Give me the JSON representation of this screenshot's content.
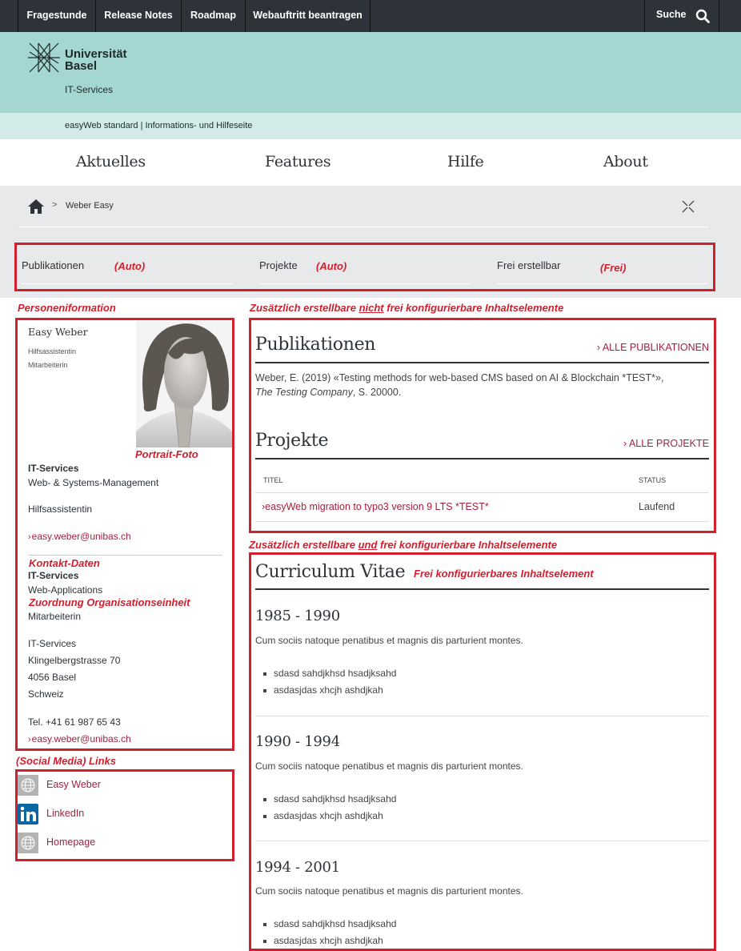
{
  "topbar": {
    "items": [
      "Fragestunde",
      "Release Notes",
      "Roadmap",
      "Webauftritt beantragen"
    ],
    "search_label": "Suche",
    "search_icon": "magnifier-icon"
  },
  "header": {
    "logo_line1": "Universität",
    "logo_line2": "Basel",
    "unit": "IT-Services",
    "subtitle": "easyWeb standard | Informations- und Hilfeseite"
  },
  "mainnav": [
    "Aktuelles",
    "Features",
    "Hilfe",
    "About"
  ],
  "breadcrumb": {
    "home_icon": "home-icon",
    "separator": ">",
    "current": "Weber Easy",
    "expand_icon": "expand-icon"
  },
  "tabs": [
    {
      "label": "Publikationen",
      "annotation": "(Auto)"
    },
    {
      "label": "Projekte",
      "annotation": "(Auto)"
    },
    {
      "label": "Frei erstellbar",
      "annotation": "(Frei)"
    }
  ],
  "annotations": {
    "person": "Personeniformation",
    "portrait": "Portrait-Foto",
    "contact": "Kontakt-Daten",
    "org": "Zuordnung Organisationseinheit",
    "social": "(Social Media) Links",
    "right_top_pre": "Zusätzlich erstellbare ",
    "right_top_u": "nicht",
    "right_top_post": " frei konfigurierbare Inhaltselemente",
    "right_bottom_pre": "Zusätzlich erstellbare ",
    "right_bottom_u": "und",
    "right_bottom_post": " frei konfigurierbare Inhaltselemente",
    "cv_note": "Frei konfigurierbares Inhaltselement"
  },
  "person": {
    "name": "Easy Weber",
    "roles": [
      "Hilfsassistentin",
      "Mitarbeiterin"
    ],
    "org1": "IT-Services",
    "dept1": "Web- & Systems-Management",
    "function": "Hilfsassistentin",
    "email1": "easy.weber@unibas.ch",
    "org2": "IT-Services",
    "dept2": "Web-Applications",
    "role2": "Mitarbeiterin",
    "address": [
      "IT-Services",
      "Klingelbergstrasse 70",
      "4056 Basel",
      "Schweiz"
    ],
    "phone": "Tel. +41 61 987 65 43",
    "email2": "easy.weber@unibas.ch"
  },
  "social": [
    {
      "icon": "globe-icon",
      "label": "Easy Weber"
    },
    {
      "icon": "linkedin-icon",
      "label": "LinkedIn"
    },
    {
      "icon": "globe-icon",
      "label": "Homepage"
    }
  ],
  "publications": {
    "title": "Publikationen",
    "all_link": "ALLE PUBLIKATIONEN",
    "entry_main": "Weber, E. (2019) «Testing methods for web-based CMS based on AI & Blockchain *TEST*»,",
    "entry_publisher": "The Testing Company",
    "entry_pages": ", S. 20000."
  },
  "projects": {
    "title": "Projekte",
    "all_link": "ALLE PROJEKTE",
    "col_title": "TITEL",
    "col_status": "STATUS",
    "rows": [
      {
        "title": "easyWeb migration to typo3 version 9 LTS *TEST*",
        "status": "Laufend"
      }
    ]
  },
  "cv": {
    "title": "Curriculum Vitae",
    "entries": [
      {
        "years": "1985 - 1990",
        "desc": "Cum sociis natoque penatibus et magnis dis parturient montes.",
        "bullets": [
          "sdasd sahdjkhsd hsadjksahd",
          "asdasjdas xhcjh ashdjkah"
        ]
      },
      {
        "years": "1990 - 1994",
        "desc": "Cum sociis natoque penatibus et magnis dis parturient montes.",
        "bullets": [
          "sdasd sahdjkhsd hsadjksahd",
          "asdasjdas xhcjh ashdjkah"
        ]
      },
      {
        "years": "1994 - 2001",
        "desc": "Cum sociis natoque penatibus et magnis dis parturient montes.",
        "bullets": [
          "sdasd sahdjkhsd hsadjksahd",
          "asdasjdas xhcjh ashdjkah"
        ]
      }
    ]
  },
  "colors": {
    "topbar": "#2d3339",
    "header_mint": "#a5d7d2",
    "subband": "#d2ebe8",
    "gray_area": "#e8e9ea",
    "link": "#a5203f",
    "annotation_red": "#d0202e"
  }
}
